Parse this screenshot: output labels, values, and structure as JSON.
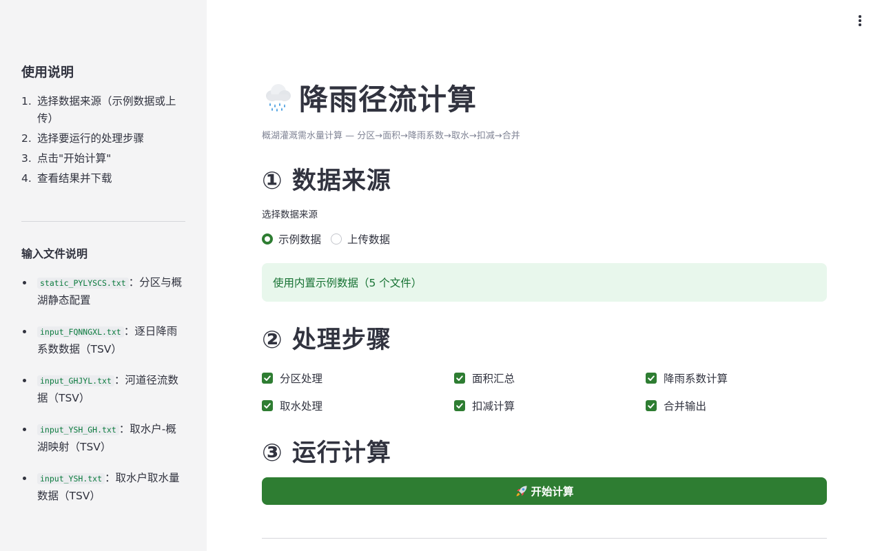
{
  "sidebar": {
    "usage_title": "使用说明",
    "steps": [
      {
        "num": "1.",
        "text": "选择数据来源（示例数据或上传）"
      },
      {
        "num": "2.",
        "text": "选择要运行的处理步骤"
      },
      {
        "num": "3.",
        "text": "点击\"开始计算\""
      },
      {
        "num": "4.",
        "text": "查看结果并下载"
      }
    ],
    "files_title": "输入文件说明",
    "files": [
      {
        "name": "static_PYLYSCS.txt",
        "desc": "：分区与概湖静态配置"
      },
      {
        "name": "input_FQNNGXL.txt",
        "desc": "：逐日降雨系数数据（TSV）"
      },
      {
        "name": "input_GHJYL.txt",
        "desc": "：河道径流数据（TSV）"
      },
      {
        "name": "input_YSH_GH.txt",
        "desc": "：取水户-概湖映射（TSV）"
      },
      {
        "name": "input_YSH.txt",
        "desc": "：取水户取水量数据（TSV）"
      }
    ]
  },
  "main": {
    "title_icon": "cloud-rain-icon",
    "title": "降雨径流计算",
    "caption": "概湖灌溉需水量计算 — 分区→面积→降雨系数→取水→扣减→合并",
    "section1": "① 数据来源",
    "radio_label": "选择数据来源",
    "radio_options": [
      "示例数据",
      "上传数据"
    ],
    "radio_selected": "示例数据",
    "info_text": "使用内置示例数据（5 个文件）",
    "section2": "② 处理步骤",
    "steps": [
      {
        "label": "分区处理",
        "checked": true
      },
      {
        "label": "面积汇总",
        "checked": true
      },
      {
        "label": "降雨系数计算",
        "checked": true
      },
      {
        "label": "取水处理",
        "checked": true
      },
      {
        "label": "扣减计算",
        "checked": true
      },
      {
        "label": "合并输出",
        "checked": true
      }
    ],
    "section3": "③ 运行计算",
    "run_icon": "rocket-icon",
    "run_label": "开始计算"
  },
  "colors": {
    "primary": "#2e7d32",
    "info_bg": "#e8f7ec",
    "info_text": "#177233",
    "sidebar_bg": "#f4f4f5"
  }
}
